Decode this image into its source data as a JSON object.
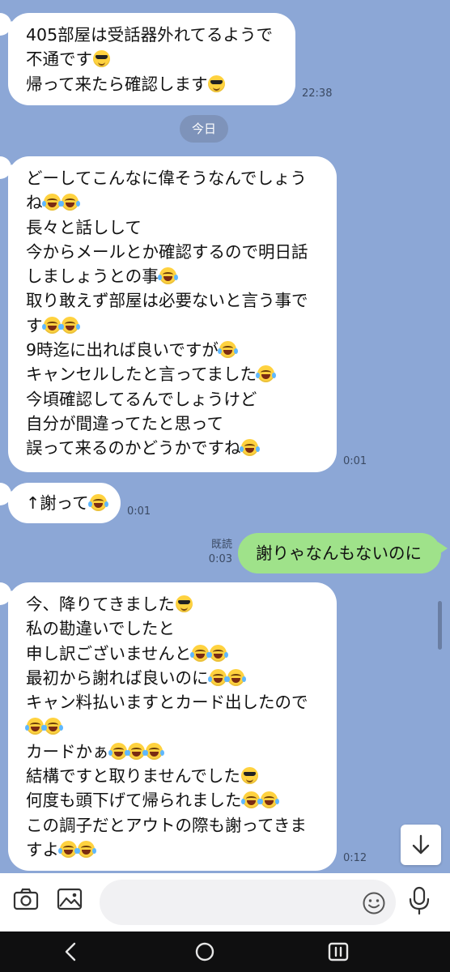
{
  "messages": [
    {
      "side": "in",
      "lines": [
        {
          "text": "405部屋は受話器外れてるようで",
          "emoji": []
        },
        {
          "text": "不通です",
          "emoji": [
            "cool"
          ]
        },
        {
          "text": "帰って来たら確認します",
          "emoji": [
            "cool"
          ]
        }
      ],
      "time": "22:38"
    },
    {
      "side": "in",
      "lines": [
        {
          "text": "どーしてこんなに偉そうなんでしょう",
          "emoji": []
        },
        {
          "text": "ね",
          "emoji": [
            "joy",
            "joy"
          ]
        },
        {
          "text": "長々と話しして",
          "emoji": []
        },
        {
          "text": "今からメールとか確認するので明日話",
          "emoji": []
        },
        {
          "text": "しましょうとの事",
          "emoji": [
            "joy"
          ]
        },
        {
          "text": "取り敢えず部屋は必要ないと言う事で",
          "emoji": []
        },
        {
          "text": "す",
          "emoji": [
            "joy",
            "joy"
          ]
        },
        {
          "text": "9時迄に出れば良いですが",
          "emoji": [
            "joy"
          ]
        },
        {
          "text": "キャンセルしたと言ってました",
          "emoji": [
            "joy"
          ]
        },
        {
          "text": "今頃確認してるんでしょうけど",
          "emoji": []
        },
        {
          "text": "自分が間違ってたと思って",
          "emoji": []
        },
        {
          "text": "誤って来るのかどうかですね",
          "emoji": [
            "joy"
          ]
        }
      ],
      "time": "0:01"
    },
    {
      "side": "in",
      "lines": [
        {
          "text": "↑謝って",
          "emoji": [
            "joy"
          ]
        }
      ],
      "time": "0:01"
    },
    {
      "side": "out",
      "lines": [
        {
          "text": "謝りゃなんもないのに",
          "emoji": []
        }
      ],
      "read": "既読",
      "time": "0:03"
    },
    {
      "side": "in",
      "lines": [
        {
          "text": "今、降りてきました",
          "emoji": [
            "cool"
          ]
        },
        {
          "text": "私の勘違いでしたと",
          "emoji": []
        },
        {
          "text": "申し訳ございませんと",
          "emoji": [
            "joy",
            "joy"
          ]
        },
        {
          "text": "最初から謝れば良いのに",
          "emoji": [
            "joy",
            "joy"
          ]
        },
        {
          "text": "キャン料払いますとカード出したので",
          "emoji": []
        },
        {
          "text": "",
          "emoji": [
            "joy",
            "joy"
          ]
        },
        {
          "text": "カードかぁ",
          "emoji": [
            "joy",
            "joy",
            "joy"
          ]
        },
        {
          "text": "結構ですと取りませんでした",
          "emoji": [
            "cool"
          ]
        },
        {
          "text": "何度も頭下げて帰られました",
          "emoji": [
            "joy",
            "joy"
          ]
        },
        {
          "text": "この調子だとアウトの際も謝ってきま",
          "emoji": []
        },
        {
          "text": "すよ",
          "emoji": [
            "joy",
            "joy"
          ]
        }
      ],
      "time": "0:12"
    }
  ],
  "date_divider": "今日",
  "input": {
    "placeholder": ""
  },
  "icons": {
    "camera": "camera-icon",
    "image": "image-icon",
    "emoji": "emoji-icon",
    "mic": "microphone-icon",
    "scroll_down": "arrow-down-icon",
    "nav_back": "back-icon",
    "nav_home": "home-icon",
    "nav_recent": "recents-icon"
  },
  "colors": {
    "chat_bg": "#8ca7d6",
    "incoming_bubble": "#ffffff",
    "outgoing_bubble": "#9fe28a",
    "date_pill": "#7e93ba"
  }
}
